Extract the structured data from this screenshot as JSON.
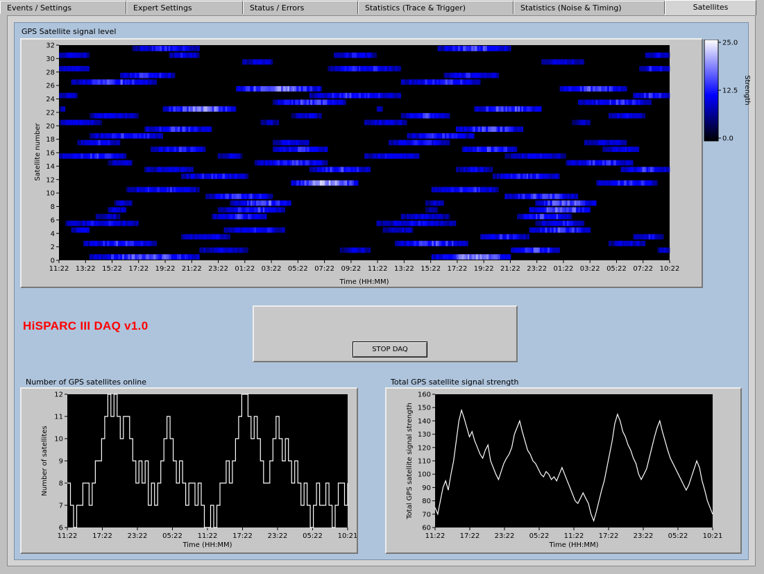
{
  "tabs": [
    "Events / Settings",
    "Expert Settings",
    "Status / Errors",
    "Statistics (Trace & Trigger)",
    "Statistics (Noise & Timing)",
    "Satellites"
  ],
  "active_tab": "Satellites",
  "daq_title": "HiSPARC III  DAQ v1.0",
  "stop_button_label": "STOP DAQ",
  "colors": {
    "panel_bg": "#aec4dc",
    "plot_bg": "#000000",
    "heat_low": "#0000ff",
    "heat_high": "#ffffff",
    "title": "#ff0000"
  },
  "chart_data": [
    {
      "type": "heatmap",
      "title": "GPS Satellite signal level",
      "xlabel": "Time (HH:MM)",
      "ylabel": "Satellite number",
      "x_ticks": [
        "11:22",
        "13:22",
        "15:22",
        "17:22",
        "19:22",
        "21:22",
        "23:22",
        "01:22",
        "03:22",
        "05:22",
        "07:22",
        "09:22",
        "11:22",
        "13:22",
        "15:22",
        "17:22",
        "19:22",
        "21:22",
        "23:22",
        "01:22",
        "03:22",
        "05:22",
        "07:22",
        "10:22"
      ],
      "y_ticks": [
        0,
        2,
        4,
        6,
        8,
        10,
        12,
        14,
        16,
        18,
        20,
        22,
        24,
        26,
        28,
        30,
        32
      ],
      "ylim": [
        0,
        32
      ],
      "colorbar": {
        "label": "Strength",
        "ticks": [
          "25.0",
          "12.5",
          "0.0"
        ],
        "range": [
          0,
          25
        ]
      },
      "satellite_segments": [
        {
          "sat": 0,
          "spans": [
            [
              0.05,
              0.23,
              14
            ],
            [
              0.61,
              0.74,
              16
            ]
          ]
        },
        {
          "sat": 1,
          "spans": [
            [
              0.23,
              0.31,
              9
            ],
            [
              0.46,
              0.51,
              8
            ],
            [
              0.74,
              0.82,
              13
            ],
            [
              0.98,
              1.0,
              10
            ]
          ]
        },
        {
          "sat": 2,
          "spans": [
            [
              0.04,
              0.16,
              12
            ],
            [
              0.55,
              0.67,
              13
            ],
            [
              0.9,
              0.96,
              9
            ]
          ]
        },
        {
          "sat": 3,
          "spans": [
            [
              0.2,
              0.28,
              10
            ],
            [
              0.69,
              0.77,
              11
            ],
            [
              0.94,
              0.99,
              10
            ]
          ]
        },
        {
          "sat": 4,
          "spans": [
            [
              0.02,
              0.05,
              9
            ],
            [
              0.27,
              0.37,
              11
            ],
            [
              0.53,
              0.58,
              8
            ],
            [
              0.77,
              0.87,
              13
            ]
          ]
        },
        {
          "sat": 5,
          "spans": [
            [
              0.01,
              0.13,
              10
            ],
            [
              0.52,
              0.65,
              10
            ],
            [
              0.78,
              0.86,
              11
            ]
          ]
        },
        {
          "sat": 6,
          "spans": [
            [
              0.06,
              0.1,
              8
            ],
            [
              0.25,
              0.34,
              12
            ],
            [
              0.56,
              0.64,
              9
            ],
            [
              0.75,
              0.84,
              13
            ]
          ]
        },
        {
          "sat": 7,
          "spans": [
            [
              0.08,
              0.11,
              9
            ],
            [
              0.26,
              0.37,
              12
            ],
            [
              0.6,
              0.62,
              7
            ],
            [
              0.77,
              0.87,
              15
            ]
          ]
        },
        {
          "sat": 8,
          "spans": [
            [
              0.09,
              0.12,
              9
            ],
            [
              0.28,
              0.38,
              14
            ],
            [
              0.6,
              0.63,
              8
            ],
            [
              0.78,
              0.88,
              15
            ]
          ]
        },
        {
          "sat": 9,
          "spans": [
            [
              0.24,
              0.35,
              12
            ],
            [
              0.73,
              0.85,
              13
            ]
          ]
        },
        {
          "sat": 10,
          "spans": [
            [
              0.11,
              0.23,
              11
            ],
            [
              0.61,
              0.72,
              12
            ]
          ]
        },
        {
          "sat": 11,
          "spans": [
            [
              0.38,
              0.49,
              18
            ],
            [
              0.88,
              0.98,
              12
            ]
          ]
        },
        {
          "sat": 12,
          "spans": [
            [
              0.2,
              0.31,
              11
            ],
            [
              0.71,
              0.82,
              11
            ]
          ]
        },
        {
          "sat": 13,
          "spans": [
            [
              0.14,
              0.22,
              9
            ],
            [
              0.41,
              0.51,
              12
            ],
            [
              0.65,
              0.71,
              9
            ],
            [
              0.92,
              1.0,
              12
            ]
          ]
        },
        {
          "sat": 14,
          "spans": [
            [
              0.08,
              0.12,
              8
            ],
            [
              0.32,
              0.44,
              12
            ],
            [
              0.83,
              0.94,
              12
            ]
          ]
        },
        {
          "sat": 15,
          "spans": [
            [
              0.0,
              0.11,
              12
            ],
            [
              0.26,
              0.3,
              8
            ],
            [
              0.5,
              0.59,
              11
            ],
            [
              0.73,
              0.83,
              9
            ]
          ]
        },
        {
          "sat": 16,
          "spans": [
            [
              0.15,
              0.24,
              11
            ],
            [
              0.35,
              0.44,
              12
            ],
            [
              0.66,
              0.75,
              13
            ],
            [
              0.89,
              0.95,
              10
            ]
          ]
        },
        {
          "sat": 17,
          "spans": [
            [
              0.03,
              0.1,
              11
            ],
            [
              0.35,
              0.41,
              10
            ],
            [
              0.54,
              0.64,
              11
            ],
            [
              0.86,
              0.93,
              9
            ]
          ]
        },
        {
          "sat": 18,
          "spans": [
            [
              0.05,
              0.17,
              12
            ],
            [
              0.57,
              0.68,
              12
            ]
          ]
        },
        {
          "sat": 19,
          "spans": [
            [
              0.14,
              0.25,
              12
            ],
            [
              0.65,
              0.76,
              13
            ]
          ]
        },
        {
          "sat": 20,
          "spans": [
            [
              0.0,
              0.07,
              10
            ],
            [
              0.33,
              0.36,
              7
            ],
            [
              0.5,
              0.57,
              9
            ],
            [
              0.84,
              0.87,
              7
            ]
          ]
        },
        {
          "sat": 21,
          "spans": [
            [
              0.05,
              0.13,
              10
            ],
            [
              0.38,
              0.43,
              9
            ],
            [
              0.56,
              0.64,
              12
            ],
            [
              0.9,
              0.96,
              9
            ]
          ]
        },
        {
          "sat": 22,
          "spans": [
            [
              0.0,
              0.01,
              7
            ],
            [
              0.17,
              0.29,
              16
            ],
            [
              0.52,
              0.53,
              7
            ],
            [
              0.68,
              0.79,
              14
            ]
          ]
        },
        {
          "sat": 23,
          "spans": [
            [
              0.35,
              0.47,
              13
            ],
            [
              0.85,
              0.97,
              12
            ]
          ]
        },
        {
          "sat": 24,
          "spans": [
            [
              0.0,
              0.03,
              9
            ],
            [
              0.41,
              0.56,
              12
            ],
            [
              0.94,
              1.0,
              12
            ]
          ]
        },
        {
          "sat": 25,
          "spans": [
            [
              0.29,
              0.43,
              16
            ],
            [
              0.82,
              0.93,
              14
            ]
          ]
        },
        {
          "sat": 26,
          "spans": [
            [
              0.02,
              0.16,
              13
            ],
            [
              0.56,
              0.69,
              12
            ]
          ]
        },
        {
          "sat": 27,
          "spans": [
            [
              0.1,
              0.19,
              12
            ],
            [
              0.63,
              0.72,
              11
            ]
          ]
        },
        {
          "sat": 28,
          "spans": [
            [
              0.0,
              0.05,
              10
            ],
            [
              0.44,
              0.56,
              11
            ],
            [
              0.95,
              1.0,
              11
            ]
          ]
        },
        {
          "sat": 29,
          "spans": [
            [
              0.3,
              0.35,
              9
            ],
            [
              0.79,
              0.86,
              9
            ]
          ]
        },
        {
          "sat": 30,
          "spans": [
            [
              0.0,
              0.05,
              10
            ],
            [
              0.18,
              0.23,
              10
            ],
            [
              0.45,
              0.52,
              10
            ],
            [
              0.96,
              1.0,
              10
            ]
          ]
        },
        {
          "sat": 31,
          "spans": [
            [
              0.12,
              0.23,
              11
            ],
            [
              0.62,
              0.74,
              13
            ]
          ]
        }
      ]
    },
    {
      "type": "line",
      "title": "Number of GPS satellites online",
      "xlabel": "Time (HH:MM)",
      "ylabel": "Number of satellites",
      "x_ticks": [
        "11:22",
        "17:22",
        "23:22",
        "05:22",
        "11:22",
        "17:22",
        "23:22",
        "05:22",
        "10:21"
      ],
      "y_ticks": [
        6,
        7,
        8,
        9,
        10,
        11,
        12
      ],
      "ylim": [
        6,
        12
      ],
      "series": [
        {
          "values": [
            8,
            7,
            6,
            7,
            7,
            8,
            8,
            7,
            8,
            9,
            9,
            10,
            11,
            12,
            11,
            12,
            11,
            10,
            11,
            11,
            10,
            9,
            8,
            9,
            8,
            9,
            7,
            8,
            7,
            8,
            9,
            10,
            11,
            10,
            9,
            8,
            9,
            8,
            7,
            8,
            8,
            7,
            8,
            7,
            6,
            6,
            7,
            6,
            7,
            8,
            8,
            9,
            8,
            9,
            10,
            11,
            12,
            12,
            11,
            10,
            11,
            10,
            9,
            8,
            8,
            9,
            10,
            11,
            10,
            9,
            10,
            9,
            8,
            9,
            8,
            7,
            8,
            7,
            6,
            7,
            8,
            7,
            7,
            8,
            7,
            6,
            7,
            8,
            8,
            7,
            8
          ]
        }
      ]
    },
    {
      "type": "line",
      "title": "Total GPS satellite signal strength",
      "xlabel": "Time (HH:MM)",
      "ylabel": "Total GPS satellite signal strength",
      "x_ticks": [
        "11:22",
        "17:22",
        "23:22",
        "05:22",
        "11:22",
        "17:22",
        "23:22",
        "05:22",
        "10:21"
      ],
      "y_ticks": [
        60,
        70,
        80,
        90,
        100,
        110,
        120,
        130,
        140,
        150,
        160
      ],
      "ylim": [
        60,
        160
      ],
      "series": [
        {
          "values": [
            75,
            70,
            80,
            90,
            95,
            88,
            100,
            110,
            125,
            140,
            148,
            142,
            135,
            128,
            132,
            125,
            120,
            115,
            112,
            118,
            122,
            110,
            105,
            100,
            96,
            102,
            108,
            112,
            115,
            120,
            130,
            135,
            140,
            132,
            125,
            118,
            115,
            110,
            108,
            104,
            100,
            98,
            102,
            100,
            96,
            98,
            95,
            100,
            105,
            100,
            95,
            90,
            85,
            80,
            78,
            82,
            86,
            82,
            78,
            70,
            65,
            72,
            80,
            88,
            95,
            105,
            115,
            125,
            138,
            145,
            140,
            132,
            128,
            122,
            118,
            112,
            108,
            100,
            96,
            100,
            104,
            112,
            120,
            128,
            135,
            140,
            132,
            125,
            118,
            112,
            108,
            104,
            100,
            96,
            92,
            88,
            92,
            98,
            104,
            110,
            105,
            95,
            88,
            80,
            75,
            70
          ]
        }
      ]
    }
  ]
}
